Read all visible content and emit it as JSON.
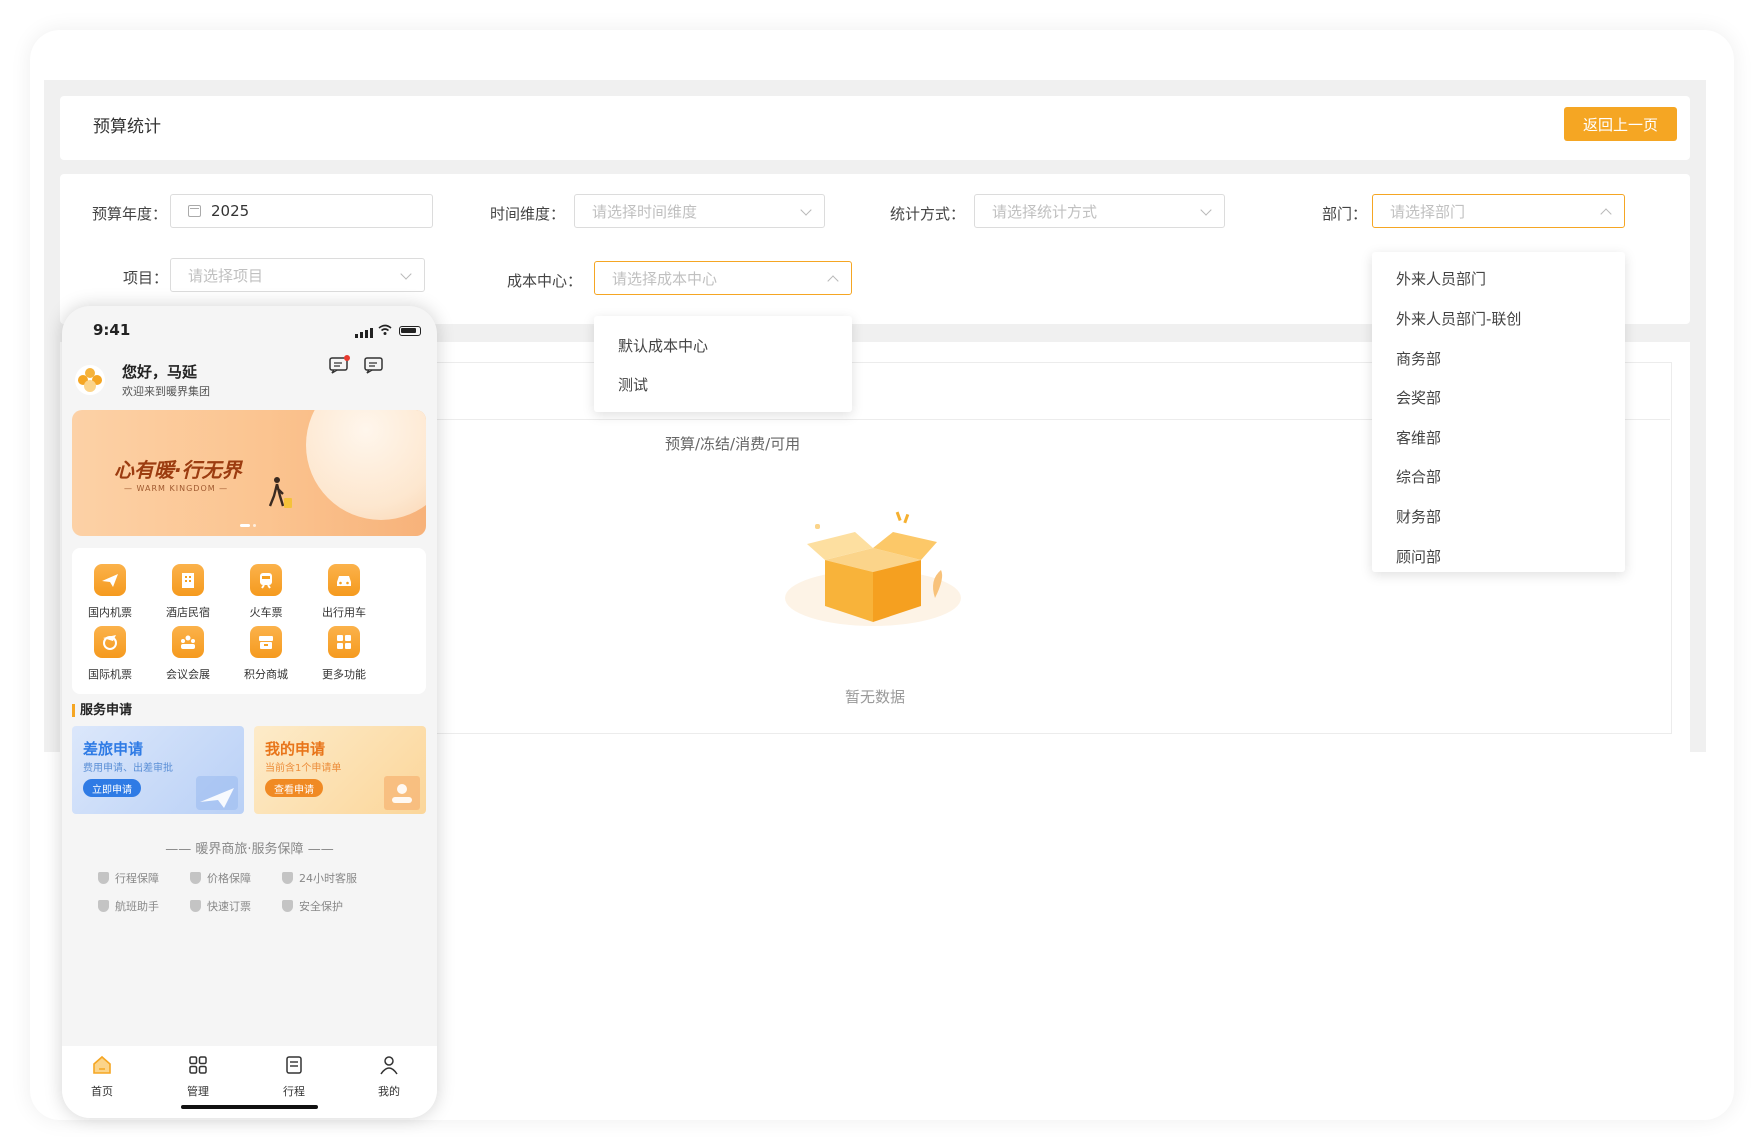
{
  "page": {
    "title": "预算统计",
    "back_label": "返回上一页"
  },
  "filters": {
    "budget_year_label": "预算年度：",
    "budget_year_value": "2025",
    "time_dimension_label": "时间维度：",
    "time_dimension_placeholder": "请选择时间维度",
    "stat_method_label": "统计方式：",
    "stat_method_placeholder": "请选择统计方式",
    "department_label": "部门：",
    "department_placeholder": "请选择部门",
    "project_label": "项目：",
    "project_placeholder": "请选择项目",
    "cost_center_label": "成本中心：",
    "cost_center_placeholder": "请选择成本中心"
  },
  "cost_center_dropdown": [
    "默认成本中心",
    "测试"
  ],
  "department_dropdown": [
    "外来人员部门",
    "外来人员部门-联创",
    "商务部",
    "会奖部",
    "客维部",
    "综合部",
    "财务部",
    "顾问部"
  ],
  "table": {
    "column_header": "预算/冻结/消费/可用",
    "empty_text": "暂无数据"
  },
  "phone": {
    "time": "9:41",
    "greeting": "您好，马延",
    "welcome": "欢迎来到暖界集团",
    "banner_slogan": "心有暖·行无界",
    "banner_sub": "— WARM KINGDOM —",
    "grid": [
      {
        "label": "国内机票",
        "icon": "plane-icon"
      },
      {
        "label": "酒店民宿",
        "icon": "hotel-icon"
      },
      {
        "label": "火车票",
        "icon": "train-icon"
      },
      {
        "label": "出行用车",
        "icon": "car-icon"
      },
      {
        "label": "国际机票",
        "icon": "globe-plane-icon"
      },
      {
        "label": "会议会展",
        "icon": "meeting-icon"
      },
      {
        "label": "积分商城",
        "icon": "mall-icon"
      },
      {
        "label": "更多功能",
        "icon": "more-icon"
      }
    ],
    "service_title": "服务申请",
    "travel_apply": {
      "title": "差旅申请",
      "sub": "费用申请、出差审批",
      "button": "立即申请"
    },
    "my_apply": {
      "title": "我的申请",
      "sub": "当前含1个申请单",
      "button": "查看申请"
    },
    "guarantee_title": "—— 暖界商旅·服务保障 ——",
    "guarantees": [
      "行程保障",
      "价格保障",
      "24小时客服",
      "航班助手",
      "快速订票",
      "安全保护"
    ],
    "tabs": [
      "首页",
      "管理",
      "行程",
      "我的"
    ],
    "colors": {
      "accent": "#f5a623",
      "blue": "#2f7be5",
      "orange": "#f08a24"
    }
  }
}
